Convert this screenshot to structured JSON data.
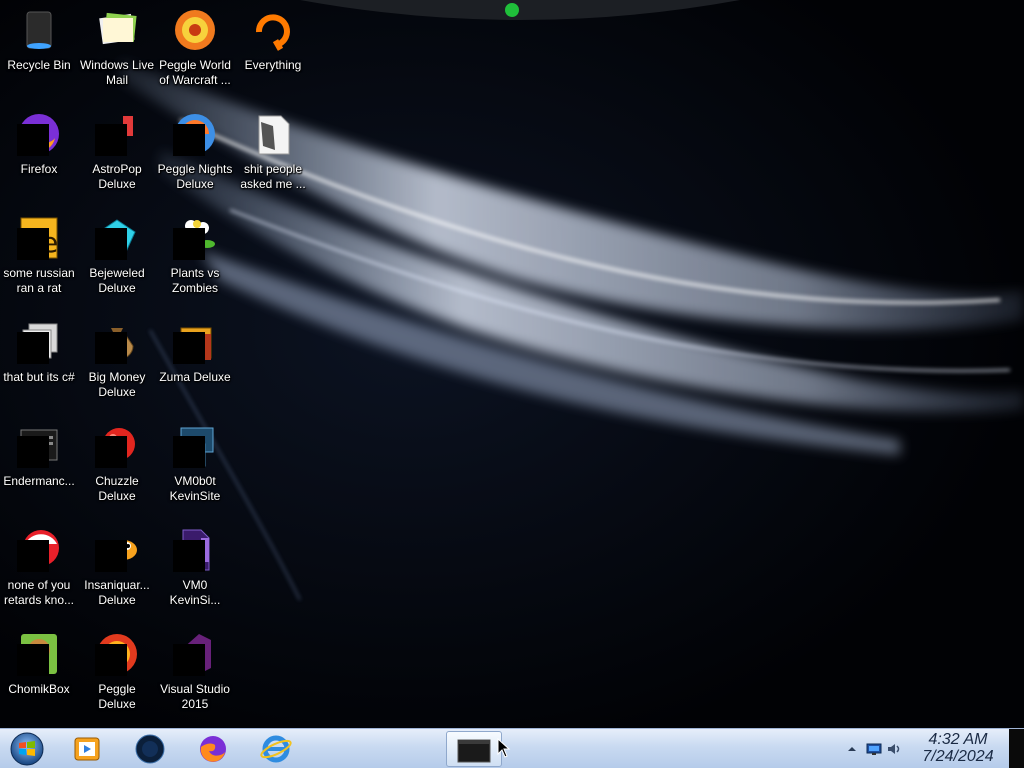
{
  "desktop": {
    "icons": [
      {
        "label": "Recycle Bin",
        "icon": "recycle-bin-icon"
      },
      {
        "label": "Windows Live Mail",
        "icon": "windows-live-mail-icon"
      },
      {
        "label": "Peggle World of Warcraft ...",
        "icon": "peggle-world-of-warcraft-icon"
      },
      {
        "label": "Everything",
        "icon": "everything-search-icon"
      },
      {
        "label": "Firefox",
        "icon": "firefox-icon"
      },
      {
        "label": "AstroPop Deluxe",
        "icon": "astropop-icon"
      },
      {
        "label": "Peggle Nights Deluxe",
        "icon": "peggle-nights-icon"
      },
      {
        "label": "shit people asked me ...",
        "icon": "text-document-icon"
      },
      {
        "label": "some russian ran a rat",
        "icon": "bitmap-file-icon"
      },
      {
        "label": "Bejeweled Deluxe",
        "icon": "bejeweled-icon"
      },
      {
        "label": "Plants vs Zombies",
        "icon": "plants-vs-zombies-icon"
      },
      {
        "label": "that but its c#",
        "icon": "copy-stack-icon"
      },
      {
        "label": "Big Money Deluxe",
        "icon": "money-bag-icon"
      },
      {
        "label": "Zuma Deluxe",
        "icon": "zuma-icon"
      },
      {
        "label": "Endermanc...",
        "icon": "application-window-icon"
      },
      {
        "label": "Chuzzle Deluxe",
        "icon": "chuzzle-icon"
      },
      {
        "label": "VM0b0t KevinSite",
        "icon": "monitor-folder-icon"
      },
      {
        "label": "none of you retards kno...",
        "icon": "red-ball-icon"
      },
      {
        "label": "Insaniquar... Deluxe",
        "icon": "fish-icon"
      },
      {
        "label": "VM0 KevinSi...",
        "icon": "purple-document-icon"
      },
      {
        "label": "ChomikBox",
        "icon": "chomikbox-icon"
      },
      {
        "label": "Peggle Deluxe",
        "icon": "peggle-deluxe-icon"
      },
      {
        "label": "Visual Studio 2015",
        "icon": "visual-studio-icon"
      }
    ]
  },
  "taskbar": {
    "start": "windows-start-orb-icon",
    "pinned": [
      {
        "name": "media-player-icon"
      },
      {
        "name": "dark-globe-icon"
      },
      {
        "name": "firefox-icon"
      },
      {
        "name": "internet-explorer-icon"
      }
    ],
    "running": [
      {
        "name": "command-window-icon"
      }
    ],
    "tray": {
      "icons": [
        "show-hidden-icons-icon",
        "network-monitor-icon",
        "volume-speaker-icon"
      ]
    },
    "clock": {
      "time": "4:32 AM",
      "date": "7/24/2024"
    }
  }
}
